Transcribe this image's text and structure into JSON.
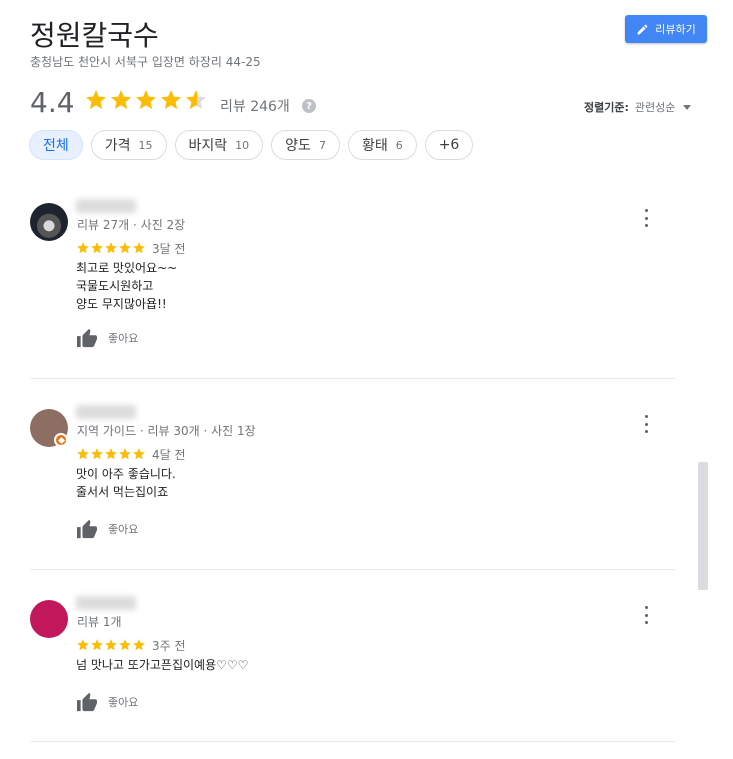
{
  "place": {
    "name": "정원칼국수",
    "address": "충청남도 천안시 서북구 입장면 하장리 44-25"
  },
  "write_review_label": "리뷰하기",
  "summary": {
    "rating": "4.4",
    "rating_value": 4.4,
    "review_count": "리뷰 246개",
    "help": "?"
  },
  "sort": {
    "label": "정렬기준:",
    "value": "관련성순"
  },
  "chips": [
    {
      "label": "전체",
      "count": ""
    },
    {
      "label": "가격",
      "count": "15"
    },
    {
      "label": "바지락",
      "count": "10"
    },
    {
      "label": "양도",
      "count": "7"
    },
    {
      "label": "황태",
      "count": "6"
    },
    {
      "label": "+6",
      "count": ""
    }
  ],
  "reviews": [
    {
      "meta": "리뷰 27개 · 사진 2장",
      "stars": 5,
      "time": "3달 전",
      "text": "최고로 맛있어요~~\n국물도시원하고\n양도 무지많아욥!!",
      "like": "좋아요"
    },
    {
      "meta": "지역 가이드 · 리뷰 30개 · 사진 1장",
      "stars": 5,
      "time": "4달 전",
      "text": "맛이 아주 좋습니다.\n줄서서 먹는집이죠",
      "like": "좋아요"
    },
    {
      "meta": "리뷰 1개",
      "stars": 5,
      "time": "3주 전",
      "text": "넘 맛나고 또가고픈집이예용♡♡♡",
      "like": "좋아요"
    }
  ],
  "colors": {
    "star": "#fbbc04",
    "accent": "#4285f4",
    "chip_active_bg": "#e8f0fe"
  }
}
